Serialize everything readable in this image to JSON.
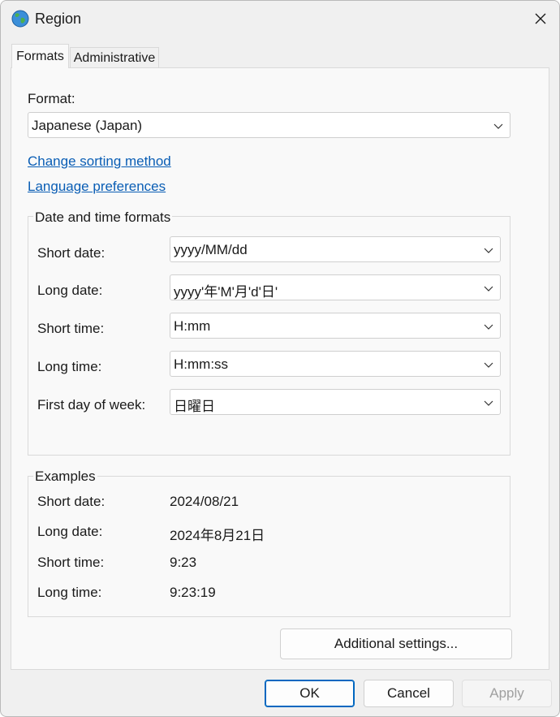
{
  "window": {
    "title": "Region",
    "icon": "globe-icon"
  },
  "tabs": [
    {
      "label": "Formats",
      "active": true
    },
    {
      "label": "Administrative",
      "active": false
    }
  ],
  "format": {
    "label": "Format:",
    "selected": "Japanese (Japan)"
  },
  "links": {
    "change_sorting": "Change sorting method",
    "language_prefs": "Language preferences"
  },
  "date_time_formats": {
    "title": "Date and time formats",
    "rows": [
      {
        "label": "Short date:",
        "value": "yyyy/MM/dd"
      },
      {
        "label": "Long date:",
        "value": "yyyy'年'M'月'd'日'"
      },
      {
        "label": "Short time:",
        "value": "H:mm"
      },
      {
        "label": "Long time:",
        "value": "H:mm:ss"
      },
      {
        "label": "First day of week:",
        "value": "日曜日"
      }
    ]
  },
  "examples": {
    "title": "Examples",
    "rows": [
      {
        "label": "Short date:",
        "value": "2024/08/21"
      },
      {
        "label": "Long date:",
        "value": "2024年8月21日"
      },
      {
        "label": "Short time:",
        "value": "9:23"
      },
      {
        "label": "Long time:",
        "value": "9:23:19"
      }
    ]
  },
  "buttons": {
    "additional_settings": "Additional settings...",
    "ok": "OK",
    "cancel": "Cancel",
    "apply": "Apply"
  },
  "colors": {
    "link": "#0a5eb5",
    "accent": "#0067c0",
    "panel_bg": "#f9f9f9",
    "window_bg": "#f0f0f0"
  }
}
